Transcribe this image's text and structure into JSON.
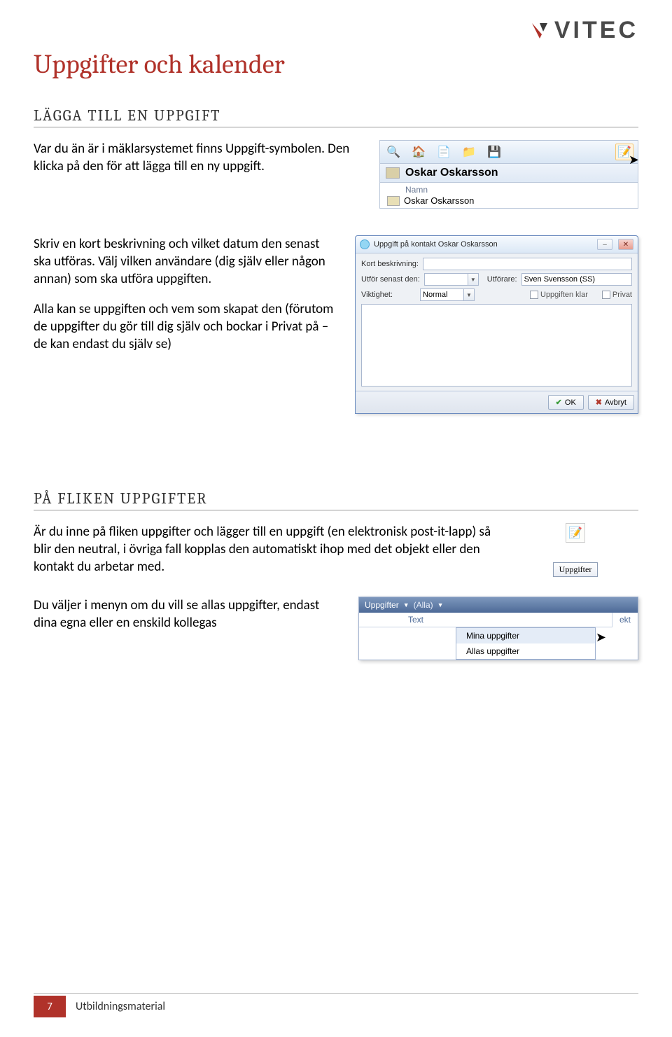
{
  "logo": {
    "text": "VITEC"
  },
  "title": "Uppgifter och kalender",
  "section1": {
    "heading": "LÄGGA TILL EN UPPGIFT",
    "p1": "Var du än är i mäklarsystemet finns Uppgift-symbolen. Den klicka på den för att lägga till en ny uppgift.",
    "p2": "Skriv en kort beskrivning och vilket datum den senast ska utföras. Välj vilken användare (dig själv eller någon annan) som ska utföra uppgiften.",
    "p3": "Alla kan se uppgiften och vem som skapat den (förutom de uppgifter du gör till dig själv och bockar i Privat på – de kan endast du själv se)"
  },
  "mock1": {
    "contact_name": "Oskar Oskarsson",
    "field_label": "Namn",
    "field_value": "Oskar Oskarsson"
  },
  "mock2": {
    "window_title": "Uppgift på kontakt Oskar Oskarsson",
    "lbl_desc": "Kort beskrivning:",
    "lbl_due": "Utför senast den:",
    "lbl_performer": "Utförare:",
    "performer_value": "Sven Svensson (SS)",
    "lbl_priority": "Viktighet:",
    "priority_value": "Normal",
    "chk_done": "Uppgiften klar",
    "chk_private": "Privat",
    "btn_ok": "OK",
    "btn_cancel": "Avbryt"
  },
  "section2": {
    "heading": "PÅ FLIKEN UPPGIFTER",
    "p1": "Är du inne på fliken uppgifter och lägger till en uppgift (en elektronisk post-it-lapp) så blir den neutral, i övriga fall kopplas den automatiskt ihop med det objekt eller den kontakt du arbetar med.",
    "p2": "Du väljer i menyn om du vill se allas uppgifter, endast dina egna eller en enskild kollegas"
  },
  "mock4": {
    "button": "Uppgifter"
  },
  "mock5": {
    "tab": "Uppgifter",
    "filter": "(Alla)",
    "col_text": "Text",
    "col_right": "ekt",
    "item1": "Mina uppgifter",
    "item2": "Allas uppgifter"
  },
  "footer": {
    "page": "7",
    "label": "Utbildningsmaterial"
  }
}
